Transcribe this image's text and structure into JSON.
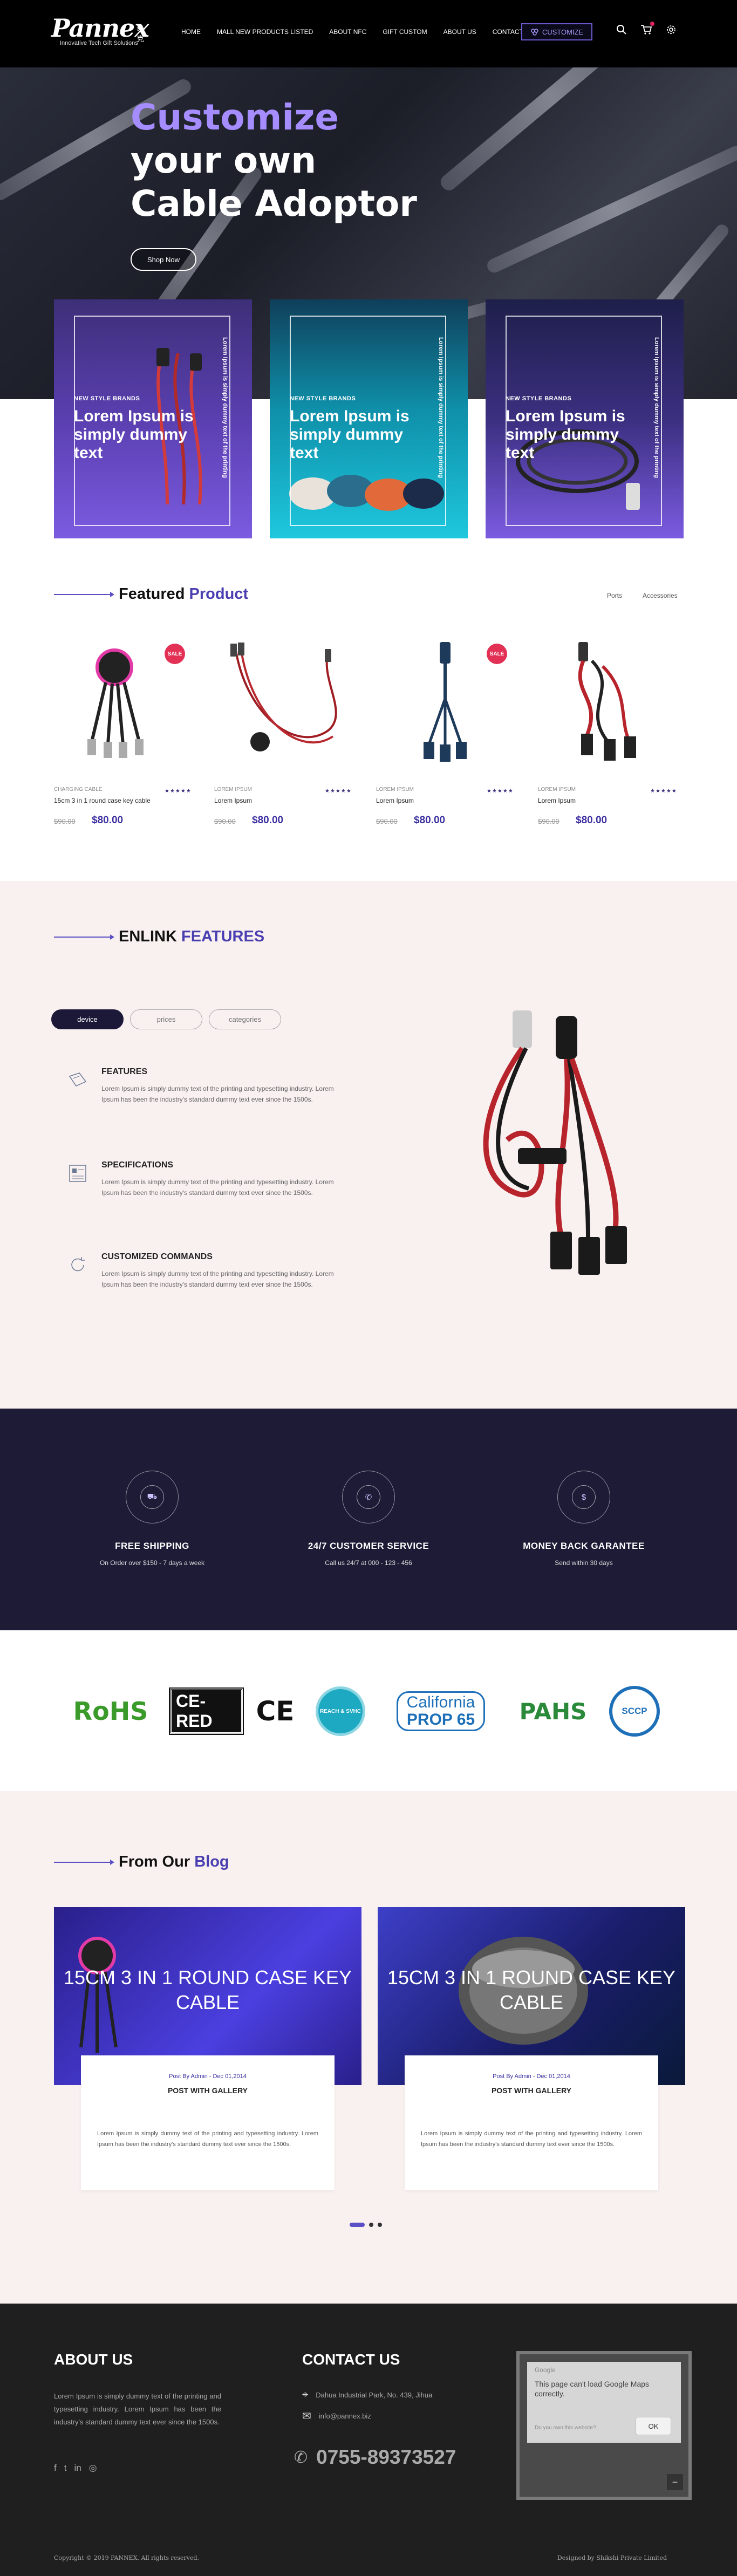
{
  "header": {
    "logo": "Pannex",
    "logo_cn": "泰克",
    "tagline": "Innovative Tech Gift Solutions",
    "nav": [
      "HOME",
      "MALL NEW PRODUCTS LISTED",
      "ABOUT NFC",
      "GIFT CUSTOM",
      "ABOUT US",
      "CONTACT"
    ],
    "customize_label": "CUSTOMIZE",
    "icons": [
      "search-icon",
      "cart-icon",
      "gear-icon"
    ]
  },
  "hero": {
    "line1": "Customize",
    "line2": "your own",
    "line3": "Cable Adoptor",
    "button": "Shop Now"
  },
  "promos": [
    {
      "tag": "NEW STYLE BRANDS",
      "title": "Lorem Ipsum is simply dummy text",
      "vertical": "Lorem Ipsum is simply dummy text of the printing",
      "color_top": "#3d2f78",
      "color_bottom": "#7b5be0"
    },
    {
      "tag": "NEW STYLE BRANDS",
      "title": "Lorem Ipsum is simply dummy text",
      "vertical": "Lorem Ipsum is simply dummy text of the printing",
      "color_top": "#0f8ea8",
      "color_bottom": "#1ec8de"
    },
    {
      "tag": "NEW STYLE BRANDS",
      "title": "Lorem Ipsum is simply dummy text",
      "vertical": "Lorem Ipsum is simply dummy text of the printing",
      "color_top": "#2b2a6a",
      "color_bottom": "#7b5be0"
    }
  ],
  "featured": {
    "heading_plain": "Featured",
    "heading_accent": "Product",
    "filters": [
      "Ports",
      "Accessories"
    ],
    "products": [
      {
        "category": "CHARGING CABLE",
        "name": "15cm 3 in 1 round case key cable",
        "stars": "★★★★★",
        "old_price": "$90.00",
        "price": "$80.00",
        "badge": "SALE"
      },
      {
        "category": "Lorem Ipsum",
        "name": "Lorem Ipsum",
        "stars": "★★★★★",
        "old_price": "$90.00",
        "price": "$80.00",
        "badge": ""
      },
      {
        "category": "Lorem Ipsum",
        "name": "Lorem Ipsum",
        "stars": "★★★★★",
        "old_price": "$90.00",
        "price": "$80.00",
        "badge": "SALE"
      },
      {
        "category": "Lorem Ipsum",
        "name": "Lorem Ipsum",
        "stars": "★★★★★",
        "old_price": "$90.00",
        "price": "$80.00",
        "badge": ""
      }
    ]
  },
  "enlink": {
    "heading_plain": "ENLINK",
    "heading_accent": "FEATURES",
    "tabs": [
      "device",
      "prices",
      "categories"
    ],
    "items": [
      {
        "title": "FEATURES",
        "desc": "Lorem Ipsum is simply dummy text of the printing and typesetting industry. Lorem Ipsum has been the industry's standard dummy text ever since the 1500s."
      },
      {
        "title": "SPECIFICATIONS",
        "desc": "Lorem Ipsum is simply dummy text of the printing and typesetting industry. Lorem Ipsum has been the industry's standard dummy text ever since the 1500s."
      },
      {
        "title": "CUSTOMIZED COMMANDS",
        "desc": "Lorem Ipsum is simply dummy text of the printing and typesetting industry. Lorem Ipsum has been the industry's standard dummy text ever since the 1500s."
      }
    ]
  },
  "services": [
    {
      "title": "FREE SHIPPING",
      "sub": "On Order over $150 - 7 days a week"
    },
    {
      "title": "24/7 CUSTOMER SERVICE",
      "sub": "Call us 24/7 at 000 - 123 - 456"
    },
    {
      "title": "MONEY BACK GARANTEE",
      "sub": "Send within 30 days"
    }
  ],
  "certs": {
    "rohs": "RoHS",
    "cered": "CE-RED",
    "ce": "CE",
    "reach": "REACH & SVHC",
    "prop_top": "California",
    "prop_bottom": "PROP 65",
    "pahs": "PAHS",
    "sccp": "SCCP"
  },
  "blog": {
    "heading_plain": "From Our",
    "heading_accent": "Blog",
    "posts": [
      {
        "image_title": "15CM 3 IN 1 ROUND CASE KEY CABLE",
        "meta": "Post By Admin - Dec 01,2014",
        "title": "POST WITH GALLERY",
        "desc": "Lorem Ipsum is simply dummy text of the printing and typesetting industry. Lorem Ipsum has been the industry's standard dummy text ever since the 1500s."
      },
      {
        "image_title": "15CM 3 IN 1 ROUND CASE KEY CABLE",
        "meta": "Post By Admin - Dec 01,2014",
        "title": "POST WITH GALLERY",
        "desc": "Lorem Ipsum is simply dummy text of the printing and typesetting industry. Lorem Ipsum has been the industry's standard dummy text ever since the 1500s."
      }
    ]
  },
  "footer": {
    "about_h": "ABOUT US",
    "about_text": "Lorem Ipsum is simply dummy text of the printing and typesetting industry. Lorem Ipsum has been the industry's standard dummy text ever since the 1500s.",
    "contact_h": "CONTACT US",
    "address": "Dahua Industrial Park, No. 439, Jihua",
    "email": "info@pannex.biz",
    "phone": "0755-89373527",
    "map_brand": "Google",
    "map_msg": "This page can't load Google Maps correctly.",
    "map_owner": "Do you own this website?",
    "map_ok": "OK",
    "copyright": "Copyright © 2019 PANNEX. All rights reserved.",
    "designer": "Designed by Shikshi Private Limited"
  }
}
